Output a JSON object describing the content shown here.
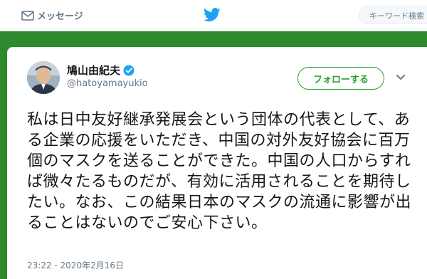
{
  "topbar": {
    "messages_label": "メッセージ",
    "search_placeholder": "キーワード検索"
  },
  "tweet": {
    "display_name": "鳩山由紀夫",
    "handle": "@hatoyamayukio",
    "follow_label": "フォローする",
    "text": "私は日中友好継承発展会という団体の代表として、ある企業の応援をいただき、中国の対外友好協会に百万個のマスクを送ることができた。中国の人口からすれば微々たるものだが、有効に活用されることを期待したい。なお、この結果日本のマスクの流通に影響が出ることはないのでご安心下さい。",
    "timestamp": "23:22 - 2020年2月16日"
  },
  "colors": {
    "accent_green": "#2aa12a",
    "background_green": "#2f8a2f",
    "verified_blue": "#1da1f2"
  },
  "icons": [
    "envelope-icon",
    "twitter-bird-icon",
    "verified-badge-icon",
    "chevron-down-icon"
  ]
}
